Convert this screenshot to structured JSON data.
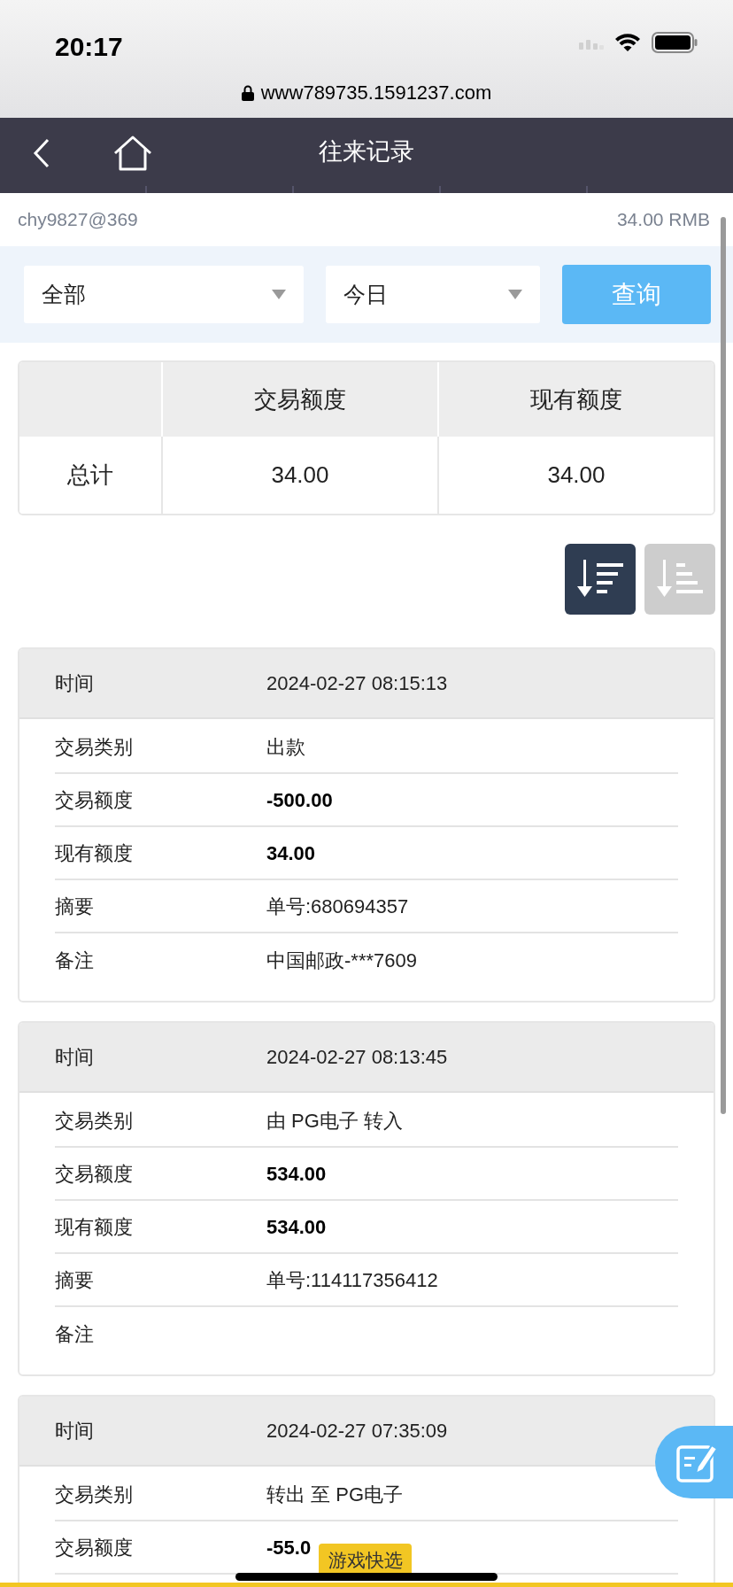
{
  "status_bar": {
    "time": "20:17"
  },
  "browser": {
    "url": "www789735.1591237.com"
  },
  "nav": {
    "title": "往来记录"
  },
  "account": {
    "user": "chy9827@369",
    "balance": "34.00 RMB"
  },
  "filters": {
    "selects": [
      {
        "value": "全部"
      },
      {
        "value": "今日"
      }
    ],
    "button": "查询"
  },
  "summary": {
    "columns": [
      "交易额度",
      "现有额度"
    ],
    "rows": [
      {
        "label": "总计",
        "cells": [
          "34.00",
          "34.00"
        ]
      }
    ]
  },
  "sort_buttons": [
    {
      "kind": "descending",
      "selected": true
    },
    {
      "kind": "ascending",
      "selected": false
    }
  ],
  "records": [
    {
      "time_label": "时间",
      "time": "2024-02-27 08:15:13",
      "fields": [
        {
          "label": "交易类别",
          "value": "出款",
          "emphasis": false
        },
        {
          "label": "交易额度",
          "value": "-500.00",
          "emphasis": true
        },
        {
          "label": "现有额度",
          "value": "34.00",
          "emphasis": true
        },
        {
          "label": "摘要",
          "value": "单号:680694357",
          "emphasis": false
        },
        {
          "label": "备注",
          "value": "中国邮政-***7609",
          "emphasis": false
        }
      ]
    },
    {
      "time_label": "时间",
      "time": "2024-02-27 08:13:45",
      "fields": [
        {
          "label": "交易类别",
          "value": "由 PG电子 转入",
          "emphasis": false
        },
        {
          "label": "交易额度",
          "value": "534.00",
          "emphasis": true
        },
        {
          "label": "现有额度",
          "value": "534.00",
          "emphasis": true
        },
        {
          "label": "摘要",
          "value": "单号:114117356412",
          "emphasis": false
        },
        {
          "label": "备注"
        }
      ]
    },
    {
      "time_label": "时间",
      "time": "2024-02-27 07:35:09",
      "fields": [
        {
          "label": "交易类别",
          "value": "转出 至 PG电子",
          "emphasis": false
        },
        {
          "label": "交易额度",
          "value": "-55.0",
          "emphasis": true
        }
      ]
    }
  ],
  "bottom_tab": {
    "label": "游戏快选"
  }
}
